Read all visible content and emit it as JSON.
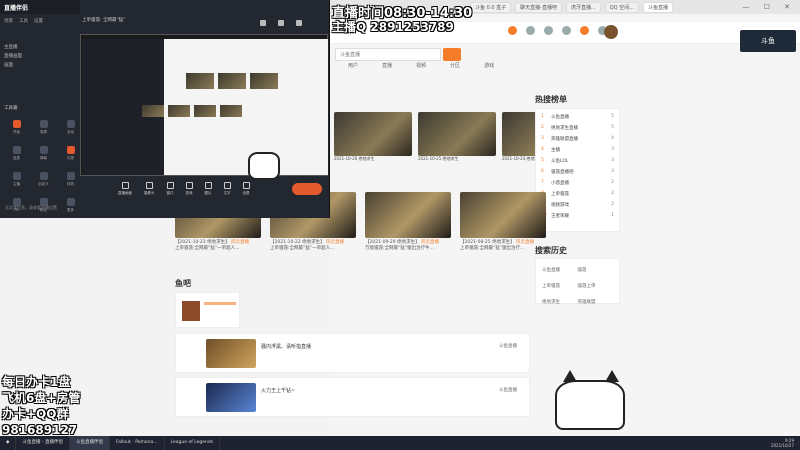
{
  "browser": {
    "tabs": [
      "斗鱼 0.0 盒子",
      "聊天直播-直播吧",
      "虎牙直播...",
      "QQ 空间...",
      "网页..."
    ],
    "active_tab": "斗鱼直播",
    "window_controls": "— ☐ ✕"
  },
  "site": {
    "search_placeholder": "斗鱼直播",
    "nav": [
      "用户",
      "直播",
      "视频",
      "分区",
      "游戏"
    ],
    "logo_text": "斗鱼"
  },
  "video_row_top": [
    {
      "caption": "2021-10-26 绝地求生"
    },
    {
      "caption": "2021-10-25 绝地求生"
    },
    {
      "caption": "2021-10-24 绝地求生"
    }
  ],
  "video_row": [
    {
      "date": "【2021-10-23 绝地求生】",
      "tag": "风云直播",
      "title": "上单骚聂:全网最“猛”一单超人..."
    },
    {
      "date": "【2021-10-22 绝地求生】",
      "tag": "风云直播",
      "title": "上单骚聂:全网最“猛”一单超人..."
    },
    {
      "date": "【2021-09-29 绝地求生】",
      "tag": "风云直播",
      "title": "万能骚聂:全网最“猛”腿出治疗牛..."
    },
    {
      "date": "【2021-08-25 绝地求生】",
      "tag": "风云直播",
      "title": "上单骚聂:全网最“猛”腿出治疗..."
    }
  ],
  "sections": {
    "yuba": "鱼吧",
    "hot_rank": "热搜榜单",
    "search_history": "搜索历史"
  },
  "posts": [
    {
      "title": "骚内浮黑、请听指直播",
      "meta": "斗鱼直播"
    },
    {
      "title": "火力王上千钻~",
      "meta": "斗鱼直播"
    }
  ],
  "hot_rank": [
    {
      "rank": "1",
      "name": "斗鱼直播",
      "score": "5"
    },
    {
      "rank": "2",
      "name": "绝地求生直播",
      "score": "5"
    },
    {
      "rank": "3",
      "name": "英雄联盟直播",
      "score": "4"
    },
    {
      "rank": "4",
      "name": "主播",
      "score": "3"
    },
    {
      "rank": "5",
      "name": "斗鱼LOL",
      "score": "3"
    },
    {
      "rank": "6",
      "name": "骚聂直播吧",
      "score": "3"
    },
    {
      "rank": "7",
      "name": "小悠直播",
      "score": "2"
    },
    {
      "rank": "8",
      "name": "上单骚聂",
      "score": "2"
    },
    {
      "rank": "9",
      "name": "视频游戏",
      "score": "2"
    },
    {
      "rank": "10",
      "name": "王者荣耀",
      "score": "1"
    }
  ],
  "search_history": [
    "斗鱼直播",
    "骚聂",
    "上单骚聂",
    "骚聂上单",
    "绝地求生",
    "英雄联盟"
  ],
  "obs": {
    "app_name": "直播伴侣",
    "menu": [
      "场景",
      "工具",
      "设置"
    ],
    "scenes": [
      "主直播",
      "直播画面",
      "画面"
    ],
    "tools_label": "工具箱",
    "tools": [
      "开始",
      "录屏",
      "互动",
      "连麦",
      "弹幕",
      "礼物",
      "主播",
      "自定义",
      "特效",
      "PK",
      "粉丝",
      "更多"
    ],
    "bottom_note": "无异常信息，请查看直播设置",
    "header": "上单骚聂: 全网最“猛”",
    "toolbar": [
      "直播画面",
      "摄像头",
      "窗口",
      "游戏",
      "图片",
      "文字",
      "全屏"
    ]
  },
  "overlay": {
    "schedule": "直播时间08:30-14:30",
    "qq": "主播Q 2891253789",
    "left_lines": [
      "每日办卡1盘",
      "飞机6盘+房管",
      "办卡+QQ群",
      "981689127"
    ]
  },
  "taskbar": {
    "items": [
      "斗鱼直播 - 直播伴侣",
      "斗鱼直播伴侣",
      "Fallout - Pomona...",
      "League of Legends"
    ],
    "time": "9:29",
    "date": "2021/10/27"
  }
}
